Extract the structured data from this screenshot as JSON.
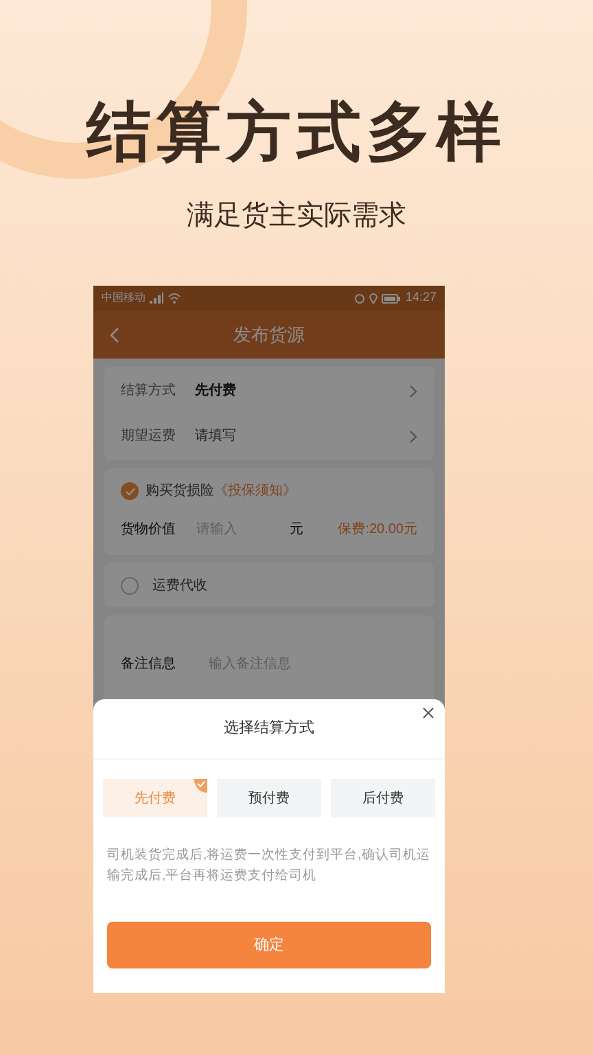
{
  "hero": {
    "title": "结算方式多样",
    "subtitle": "满足货主实际需求"
  },
  "status_bar": {
    "carrier": "中国移动",
    "time": "14:27"
  },
  "header": {
    "title": "发布货源"
  },
  "settlement": {
    "label": "结算方式",
    "value": "先付费"
  },
  "expected_fee": {
    "label": "期望运费",
    "placeholder": "请填写"
  },
  "insurance": {
    "checked": true,
    "label": "购买货损险",
    "link": "《投保须知》",
    "value_label": "货物价值",
    "placeholder": "请输入",
    "unit": "元",
    "premium": "保费:20.00元"
  },
  "collect": {
    "checked": false,
    "label": "运费代收"
  },
  "remarks": {
    "label": "备注信息",
    "placeholder": "输入备注信息"
  },
  "sheet": {
    "title": "选择结算方式",
    "options": [
      {
        "label": "先付费",
        "selected": true
      },
      {
        "label": "预付费",
        "selected": false
      },
      {
        "label": "后付费",
        "selected": false
      }
    ],
    "description": "司机装货完成后,将运费一次性支付到平台,确认司机运输完成后,平台再将运费支付给司机",
    "confirm": "确定"
  }
}
